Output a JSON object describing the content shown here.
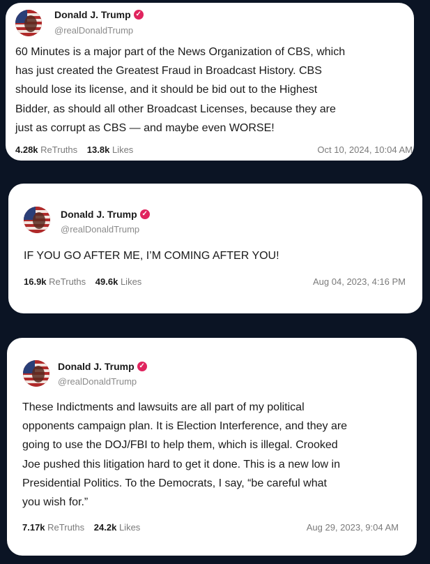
{
  "posts": [
    {
      "display_name": "Donald J. Trump",
      "handle": "@realDonaldTrump",
      "lines": [
        "60 Minutes is a major part of the News Organization of CBS, which",
        "has just created the Greatest Fraud in Broadcast History. CBS",
        "should lose its license, and it should be bid out to the Highest",
        "Bidder, as should all other Broadcast Licenses, because they are",
        "just as corrupt as CBS — and maybe even WORSE!"
      ],
      "retruths_count": "4.28k",
      "retruths_label": "ReTruths",
      "likes_count": "13.8k",
      "likes_label": "Likes",
      "timestamp": "Oct 10, 2024, 10:04 AM"
    },
    {
      "display_name": "Donald J. Trump",
      "handle": "@realDonaldTrump",
      "lines": [
        "IF YOU GO AFTER ME, I’M COMING AFTER YOU!"
      ],
      "retruths_count": "16.9k",
      "retruths_label": "ReTruths",
      "likes_count": "49.6k",
      "likes_label": "Likes",
      "timestamp": "Aug 04, 2023, 4:16 PM"
    },
    {
      "display_name": "Donald J. Trump",
      "handle": "@realDonaldTrump",
      "lines": [
        "These Indictments and lawsuits are all part of my political",
        "opponents campaign plan. It is Election Interference, and they are",
        "going to use the DOJ/FBI to help them, which is illegal. Crooked",
        "Joe pushed this litigation hard to get it done. This is a new low in",
        "Presidential Politics. To the Democrats, I say, “be careful what",
        "you wish for.”"
      ],
      "retruths_count": "7.17k",
      "retruths_label": "ReTruths",
      "likes_count": "24.2k",
      "likes_label": "Likes",
      "timestamp": "Aug 29, 2023, 9:04 AM"
    }
  ],
  "colors": {
    "background": "#0b1424",
    "card": "#ffffff",
    "verified_badge": "#e0245e"
  },
  "icons": {
    "avatar": "flag-portrait-avatar",
    "verified": "verified-badge-icon"
  }
}
